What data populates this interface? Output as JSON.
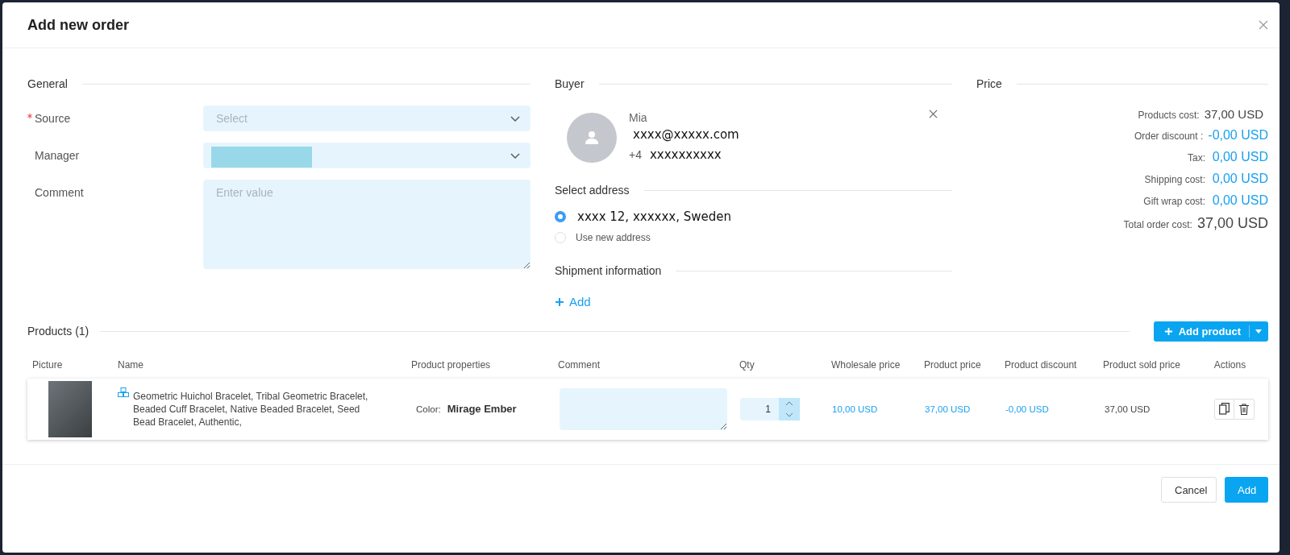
{
  "dialog": {
    "title": "Add new order"
  },
  "general": {
    "heading": "General",
    "fields": [
      {
        "kind": "select",
        "label": "Source",
        "required": true,
        "placeholder": "Select",
        "value_hidden": false
      },
      {
        "kind": "select",
        "label": "Manager",
        "required": false,
        "value_hidden": true
      },
      {
        "kind": "textarea",
        "label": "Comment",
        "required": false,
        "placeholder": "Enter value"
      }
    ]
  },
  "buyer": {
    "heading": "Buyer",
    "name": "Mia",
    "email": "xxxx@xxxxx.com",
    "phone_prefix": "+4",
    "phone": "xxxxxxxxxx"
  },
  "address": {
    "heading": "Select address",
    "options": [
      {
        "label": "xxxx 12, xxxxxx, Sweden",
        "kind": "saved",
        "selected": true
      },
      {
        "label": "Use new address",
        "kind": "new",
        "selected": false
      }
    ]
  },
  "shipment": {
    "heading": "Shipment information",
    "add_label": "Add"
  },
  "price": {
    "heading": "Price",
    "rows": [
      {
        "label": "Products cost:",
        "value": "37,00 USD",
        "kind": "plain"
      },
      {
        "label": "Order discount :",
        "value": "-0,00 USD",
        "kind": "accent"
      },
      {
        "label": "Tax:",
        "value": "0,00 USD",
        "kind": "accent"
      },
      {
        "label": "Shipping cost:",
        "value": "0,00 USD",
        "kind": "accent"
      },
      {
        "label": "Gift wrap cost:",
        "value": "0,00 USD",
        "kind": "accent"
      },
      {
        "label": "Total order cost:",
        "value": "37,00 USD",
        "kind": "total"
      }
    ]
  },
  "products": {
    "heading": "Products (1)",
    "add_button": "Add product",
    "columns": [
      "Picture",
      "Name",
      "Product properties",
      "Comment",
      "Qty",
      "Wholesale price",
      "Product price",
      "Product discount",
      "Product sold price",
      "Actions"
    ],
    "rows": [
      {
        "name": "Geometric Huichol Bracelet, Tribal Geometric Bracelet, Beaded Cuff Bracelet, Native Beaded Bracelet, Seed Bead Bracelet, Authentic,",
        "property_label": "Color:",
        "property_value": "Mirage Ember",
        "qty": "1",
        "wholesale_price": "10,00 USD",
        "product_price": "37,00 USD",
        "product_discount": "-0,00 USD",
        "sold_price": "37,00 USD"
      }
    ]
  },
  "footer": {
    "buttons": [
      {
        "label": "Cancel",
        "kind": "default"
      },
      {
        "label": "Add",
        "kind": "primary"
      }
    ]
  }
}
